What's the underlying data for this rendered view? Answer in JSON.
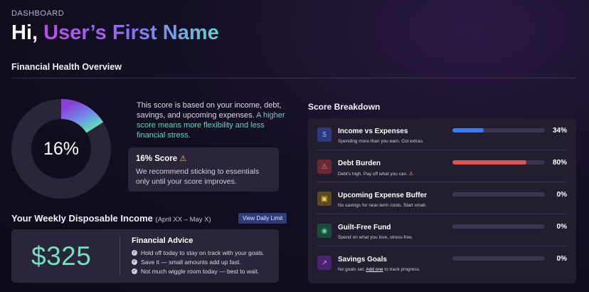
{
  "header": {
    "dashboard_label": "DASHBOARD",
    "greeting_prefix": "Hi, ",
    "user_name": "User’s First Name"
  },
  "overview": {
    "title": "Financial Health Overview",
    "score_percent": 16,
    "score_text": "16%",
    "description": "This score is based on your income, debt, savings, and upcoming expenses.",
    "description_accent": "A higher score means more flexibility and less financial stress.",
    "score_card": {
      "title": "16% Score",
      "body": "We recommend sticking to essentials only until your score improves."
    }
  },
  "weekly": {
    "title": "Your Weekly Disposable Income",
    "range": "(April XX – May X)",
    "button_label": "View Daily Limit",
    "amount": "$325",
    "advice_title": "Financial Advice",
    "advice": [
      "Hold off today to stay on track with your goals.",
      "Save it — small amounts add up fast.",
      "Not much wiggle room today — best to wait."
    ]
  },
  "breakdown": {
    "title": "Score Breakdown",
    "items": [
      {
        "label": "Income vs Expenses",
        "sub": "Spending more than you earn. Cut extras.",
        "percent_text": "34%",
        "value": 34,
        "color": "#3b7cf0",
        "icon": "$",
        "icon_bg": "#2b3a78",
        "icon_color": "#7ea3ff"
      },
      {
        "label": "Debt Burden",
        "sub": "Debt's high. Pay off what you can.",
        "percent_text": "80%",
        "value": 80,
        "color": "#e0544c",
        "icon": "⚠",
        "icon_bg": "#6a2a34",
        "icon_color": "#ff8a80"
      },
      {
        "label": "Upcoming Expense Buffer",
        "sub": "No savings for near-term costs. Start small.",
        "percent_text": "0%",
        "value": 0,
        "color": "#c9a53a",
        "icon": "▣",
        "icon_bg": "#5a4a1e",
        "icon_color": "#f2c94c"
      },
      {
        "label": "Guilt-Free Fund",
        "sub": "Spend on what you love, stress-free.",
        "percent_text": "0%",
        "value": 0,
        "color": "#3fbf8f",
        "icon": "◉",
        "icon_bg": "#1e4a3a",
        "icon_color": "#5fd6a6"
      },
      {
        "label": "Savings Goals",
        "sub_prefix": "No goals set. ",
        "sub_link": "Add one",
        "sub_suffix": " to track progress.",
        "percent_text": "0%",
        "value": 0,
        "color": "#9b4ee0",
        "icon": "↗",
        "icon_bg": "#4a2470",
        "icon_color": "#c48aff"
      }
    ]
  },
  "icons": {
    "warning": "warning-icon",
    "check": "check-circle-icon"
  },
  "colors": {
    "accent_teal": "#6fe0c2",
    "warning": "#f2c94c"
  }
}
